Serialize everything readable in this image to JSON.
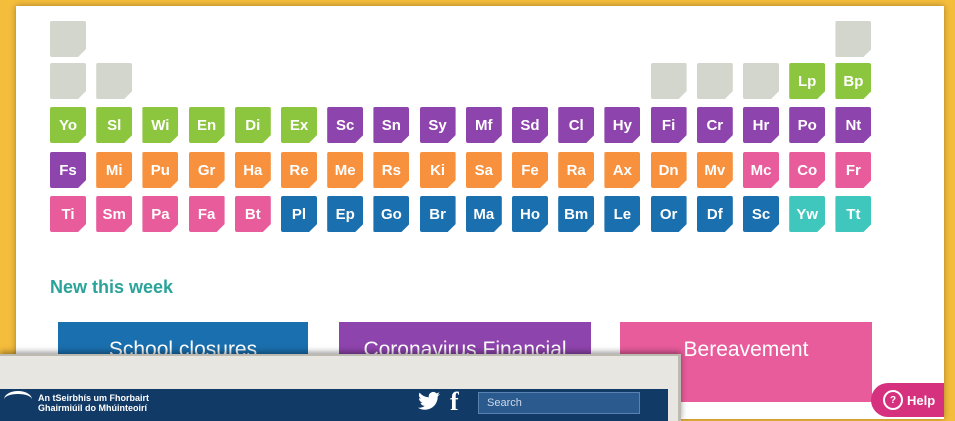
{
  "periodic_table": {
    "row0": [
      {
        "symbol": "",
        "color": "#d3d6cc"
      },
      {
        "symbol": "",
        "color": "#d3d6cc"
      }
    ],
    "row1": [
      {
        "symbol": "",
        "color": "#d3d6cc"
      },
      {
        "symbol": "",
        "color": "#d3d6cc"
      },
      {
        "symbol": "",
        "color": "#d3d6cc"
      },
      {
        "symbol": "",
        "color": "#d3d6cc"
      },
      {
        "symbol": "",
        "color": "#d3d6cc"
      },
      {
        "symbol": "Lp",
        "color": "#8cc63e"
      },
      {
        "symbol": "Bp",
        "color": "#8cc63e"
      }
    ],
    "row2": [
      {
        "symbol": "Yo",
        "color": "green"
      },
      {
        "symbol": "Sl",
        "color": "green"
      },
      {
        "symbol": "Wi",
        "color": "green"
      },
      {
        "symbol": "En",
        "color": "green"
      },
      {
        "symbol": "Di",
        "color": "green"
      },
      {
        "symbol": "Ex",
        "color": "green"
      },
      {
        "symbol": "Sc",
        "color": "purple"
      },
      {
        "symbol": "Sn",
        "color": "purple"
      },
      {
        "symbol": "Sy",
        "color": "purple"
      },
      {
        "symbol": "Mf",
        "color": "purple"
      },
      {
        "symbol": "Sd",
        "color": "purple"
      },
      {
        "symbol": "Cl",
        "color": "purple"
      },
      {
        "symbol": "Hy",
        "color": "purple"
      },
      {
        "symbol": "Fi",
        "color": "purple"
      },
      {
        "symbol": "Cr",
        "color": "purple"
      },
      {
        "symbol": "Hr",
        "color": "purple"
      },
      {
        "symbol": "Po",
        "color": "purple"
      },
      {
        "symbol": "Nt",
        "color": "purple"
      }
    ],
    "row3": [
      {
        "symbol": "Fs",
        "color": "purple"
      },
      {
        "symbol": "Mi",
        "color": "orange"
      },
      {
        "symbol": "Pu",
        "color": "orange"
      },
      {
        "symbol": "Gr",
        "color": "orange"
      },
      {
        "symbol": "Ha",
        "color": "orange"
      },
      {
        "symbol": "Re",
        "color": "orange"
      },
      {
        "symbol": "Me",
        "color": "orange"
      },
      {
        "symbol": "Rs",
        "color": "orange"
      },
      {
        "symbol": "Ki",
        "color": "orange"
      },
      {
        "symbol": "Sa",
        "color": "orange"
      },
      {
        "symbol": "Fe",
        "color": "orange"
      },
      {
        "symbol": "Ra",
        "color": "orange"
      },
      {
        "symbol": "Ax",
        "color": "orange"
      },
      {
        "symbol": "Dn",
        "color": "orange"
      },
      {
        "symbol": "Mv",
        "color": "orange"
      },
      {
        "symbol": "Mc",
        "color": "pink"
      },
      {
        "symbol": "Co",
        "color": "pink"
      },
      {
        "symbol": "Fr",
        "color": "pink"
      }
    ],
    "row4": [
      {
        "symbol": "Ti",
        "color": "pink"
      },
      {
        "symbol": "Sm",
        "color": "pink"
      },
      {
        "symbol": "Pa",
        "color": "pink"
      },
      {
        "symbol": "Fa",
        "color": "pink"
      },
      {
        "symbol": "Bt",
        "color": "pink"
      },
      {
        "symbol": "Pl",
        "color": "blue"
      },
      {
        "symbol": "Ep",
        "color": "blue"
      },
      {
        "symbol": "Go",
        "color": "blue"
      },
      {
        "symbol": "Br",
        "color": "blue"
      },
      {
        "symbol": "Ma",
        "color": "blue"
      },
      {
        "symbol": "Ho",
        "color": "blue"
      },
      {
        "symbol": "Bm",
        "color": "blue"
      },
      {
        "symbol": "Le",
        "color": "blue"
      },
      {
        "symbol": "Or",
        "color": "blue"
      },
      {
        "symbol": "Df",
        "color": "blue"
      },
      {
        "symbol": "Sc",
        "color": "blue"
      },
      {
        "symbol": "Yw",
        "color": "teal"
      },
      {
        "symbol": "Tt",
        "color": "teal"
      }
    ]
  },
  "new_this_week": {
    "heading": "New this week",
    "cards": [
      {
        "label": "School closures",
        "color": "#1a6fae"
      },
      {
        "label": "Coronavirus Financial",
        "color": "#8e44ad"
      },
      {
        "label": "Bereavement",
        "color": "#e85c9b"
      }
    ]
  },
  "help_button": {
    "label": "Help",
    "icon": "question-icon"
  },
  "popup": {
    "logo_line1": "An tSeirbhís um Fhorbairt",
    "logo_line2": "Ghairmiúil do Mhúinteoirí",
    "search_placeholder": "Search",
    "twitter_icon": "twitter-icon",
    "facebook_icon": "facebook-icon"
  },
  "colors": {
    "background": "#f5bd3c",
    "green": "#8cc63e",
    "purple": "#8e44ad",
    "orange": "#f7913d",
    "pink": "#e85c9b",
    "blue": "#1a6fae",
    "teal": "#3fc7bd",
    "heading": "#2aa39a"
  }
}
